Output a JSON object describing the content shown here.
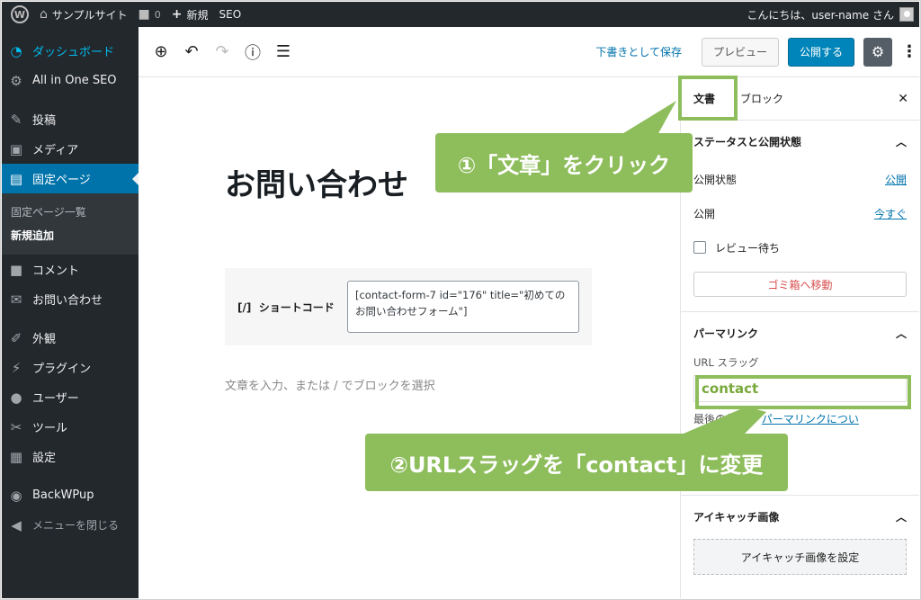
{
  "adminbar": {
    "site_name": "サンプルサイト",
    "comments_count": "0",
    "new_label": "新規",
    "seo_label": "SEO",
    "greeting": "こんにちは、user-name さん"
  },
  "sidebar": {
    "items": [
      {
        "label": "ダッシュボード",
        "icon": "dashboard-icon"
      },
      {
        "label": "All in One SEO",
        "icon": "gear-icon"
      },
      {
        "label": "投稿",
        "icon": "pin-icon"
      },
      {
        "label": "メディア",
        "icon": "media-icon"
      },
      {
        "label": "固定ページ",
        "icon": "page-icon"
      },
      {
        "label": "コメント",
        "icon": "comment-icon"
      },
      {
        "label": "お問い合わせ",
        "icon": "mail-icon"
      },
      {
        "label": "外観",
        "icon": "brush-icon"
      },
      {
        "label": "プラグイン",
        "icon": "plugin-icon"
      },
      {
        "label": "ユーザー",
        "icon": "user-icon"
      },
      {
        "label": "ツール",
        "icon": "wrench-icon"
      },
      {
        "label": "設定",
        "icon": "settings-icon"
      },
      {
        "label": "BackWPup",
        "icon": "backwpup-icon"
      }
    ],
    "submenu": [
      "固定ページ一覧",
      "新規追加"
    ],
    "collapse_label": "メニューを閉じる"
  },
  "toolbar": {
    "save_draft": "下書きとして保存",
    "preview": "プレビュー",
    "publish": "公開する"
  },
  "editor": {
    "title": "お問い合わせ",
    "shortcode_label": "ショートコード",
    "shortcode_icon_text": "[/]",
    "shortcode_value": "[contact-form-7 id=\"176\" title=\"初めてのお問い合わせフォーム\"]",
    "placeholder": "文章を入力、または / でブロックを選択"
  },
  "panel": {
    "tab_document": "文書",
    "tab_block": "ブロック",
    "status_heading": "ステータスと公開状態",
    "visibility_label": "公開状態",
    "visibility_value": "公開",
    "publish_label": "公開",
    "publish_value": "今すぐ",
    "pending_label": "レビュー待ち",
    "trash": "ゴミ箱へ移動",
    "permalink_heading": "パーマリンク",
    "slug_label": "URL スラッグ",
    "slug_value": "contact",
    "slug_help": "最後の部分。",
    "slug_help_link": "パーマリンクについ",
    "featured_heading": "アイキャッチ画像",
    "featured_button": "アイキャッチ画像を設定"
  },
  "annotations": {
    "callout1": "①「文章」をクリック",
    "callout2": "②URLスラッグを「contact」に変更",
    "accent": "#8ebd5c"
  }
}
